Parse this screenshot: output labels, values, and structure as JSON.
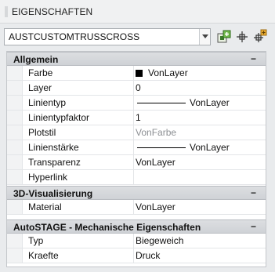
{
  "panel": {
    "title": "EIGENSCHAFTEN"
  },
  "selector": {
    "value": "AUSTCUSTOMTRUSSCROSS"
  },
  "toolbar": {
    "buttons": [
      {
        "icon": "quick-select-icon"
      },
      {
        "icon": "select-objects-icon"
      },
      {
        "icon": "pickadd-toggle-icon"
      }
    ]
  },
  "sections": [
    {
      "title": "Allgemein",
      "toggle": "−",
      "rows": [
        {
          "name": "Farbe",
          "value": "VonLayer",
          "swatch_color": "#000000"
        },
        {
          "name": "Layer",
          "value": "0"
        },
        {
          "name": "Linientyp",
          "value": "VonLayer"
        },
        {
          "name": "Linientypfaktor",
          "value": "1"
        },
        {
          "name": "Plotstil",
          "value": "VonFarbe"
        },
        {
          "name": "Linienstärke",
          "value": "VonLayer"
        },
        {
          "name": "Transparenz",
          "value": "VonLayer"
        },
        {
          "name": "Hyperlink",
          "value": ""
        }
      ]
    },
    {
      "title": "3D-Visualisierung",
      "toggle": "−",
      "rows": [
        {
          "name": "Material",
          "value": "VonLayer"
        }
      ]
    },
    {
      "title": "AutoSTAGE - Mechanische Eigenschaften",
      "toggle": "−",
      "rows": [
        {
          "name": "Typ",
          "value": "Biegeweich"
        },
        {
          "name": "Kraefte",
          "value": "Druck"
        }
      ]
    }
  ]
}
